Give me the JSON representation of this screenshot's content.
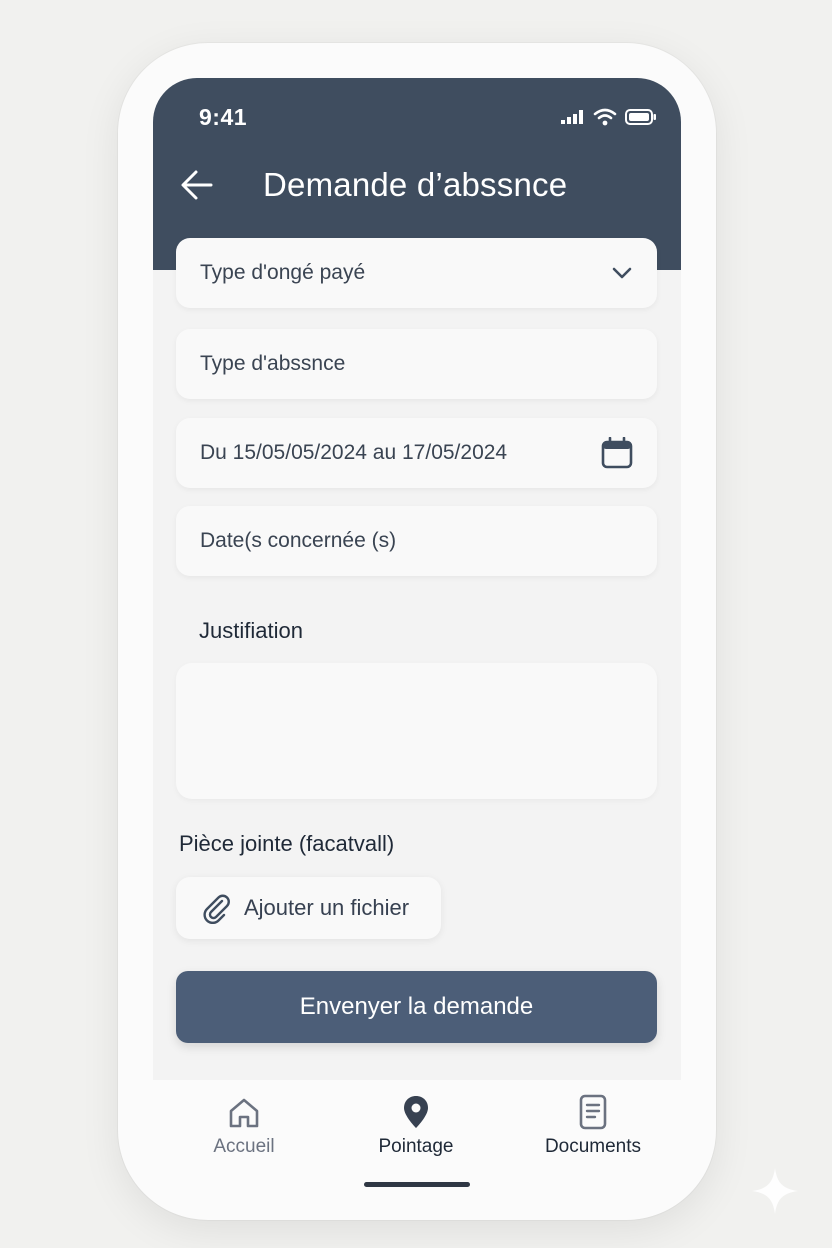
{
  "status_bar": {
    "time": "9:41",
    "icons": [
      "signal-icon",
      "wifi-icon",
      "battery-icon"
    ]
  },
  "header": {
    "back_icon": "arrow-left-icon",
    "title": "Demande d’abssnce"
  },
  "form": {
    "leave_type_select": {
      "value": "Type d'ongé payé",
      "icon": "chevron-down-icon"
    },
    "absence_type_field": {
      "value": "Type d'abssnce"
    },
    "date_range_field": {
      "value": "Du 15/05/05/2024 au 17/05/2024",
      "icon": "calendar-icon"
    },
    "concerned_dates_field": {
      "value": "Date(s concernée (s)"
    },
    "justification_label": "Justifiation",
    "justification_value": "",
    "attachment_label": "Pièce jointe (facatvall)",
    "add_file_button": {
      "label": "Ajouter un fichier",
      "icon": "paperclip-icon"
    },
    "submit_button": "Envenyer la demande"
  },
  "bottom_nav": [
    {
      "label": "Accueil",
      "icon": "home-icon",
      "active": false
    },
    {
      "label": "Pointage",
      "icon": "map-pin-icon",
      "active": true
    },
    {
      "label": "Documents",
      "icon": "document-icon",
      "active": false
    }
  ],
  "colors": {
    "header_bg": "#3f4d5f",
    "submit_bg": "#4c5e78",
    "screen_bg": "#f3f3f3",
    "nav_inactive": "#6b7280",
    "nav_active": "#374151"
  }
}
